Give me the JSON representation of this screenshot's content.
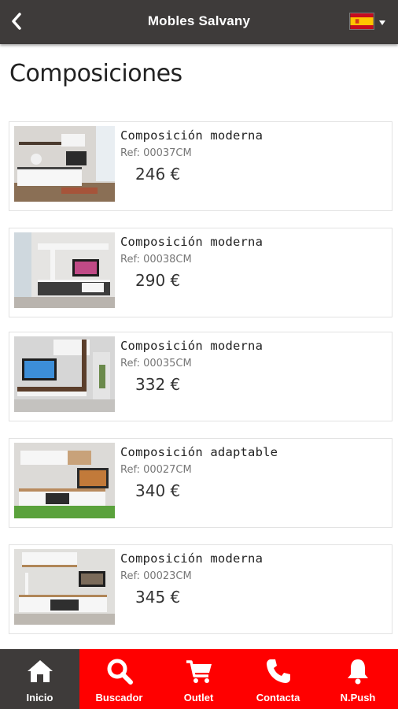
{
  "header": {
    "title": "Mobles Salvany",
    "back_icon": "chevron-left-icon",
    "language": "es",
    "language_icon": "spain-flag-icon"
  },
  "page": {
    "title": "Composiciones"
  },
  "products": [
    {
      "name": "Composición moderna",
      "ref": "Ref: 00037CM",
      "price": "246 €"
    },
    {
      "name": "Composición moderna",
      "ref": "Ref: 00038CM",
      "price": "290 €"
    },
    {
      "name": "Composición moderna",
      "ref": "Ref: 00035CM",
      "price": "332 €"
    },
    {
      "name": "Composición adaptable",
      "ref": "Ref: 00027CM",
      "price": "340 €"
    },
    {
      "name": "Composición moderna",
      "ref": "Ref: 00023CM",
      "price": "345 €"
    }
  ],
  "tabbar": {
    "active": "Inicio",
    "items": [
      {
        "label": "Inicio",
        "icon": "home-icon"
      },
      {
        "label": "Buscador",
        "icon": "search-icon"
      },
      {
        "label": "Outlet",
        "icon": "cart-icon"
      },
      {
        "label": "Contacta",
        "icon": "phone-icon"
      },
      {
        "label": "N.Push",
        "icon": "bell-icon"
      }
    ]
  },
  "colors": {
    "header_bg": "#3e3b3a",
    "tabbar_bg": "#ff0000",
    "tab_active_bg": "#3e3b3a",
    "flag_red": "#c60b1e",
    "flag_yellow": "#ffc400"
  }
}
